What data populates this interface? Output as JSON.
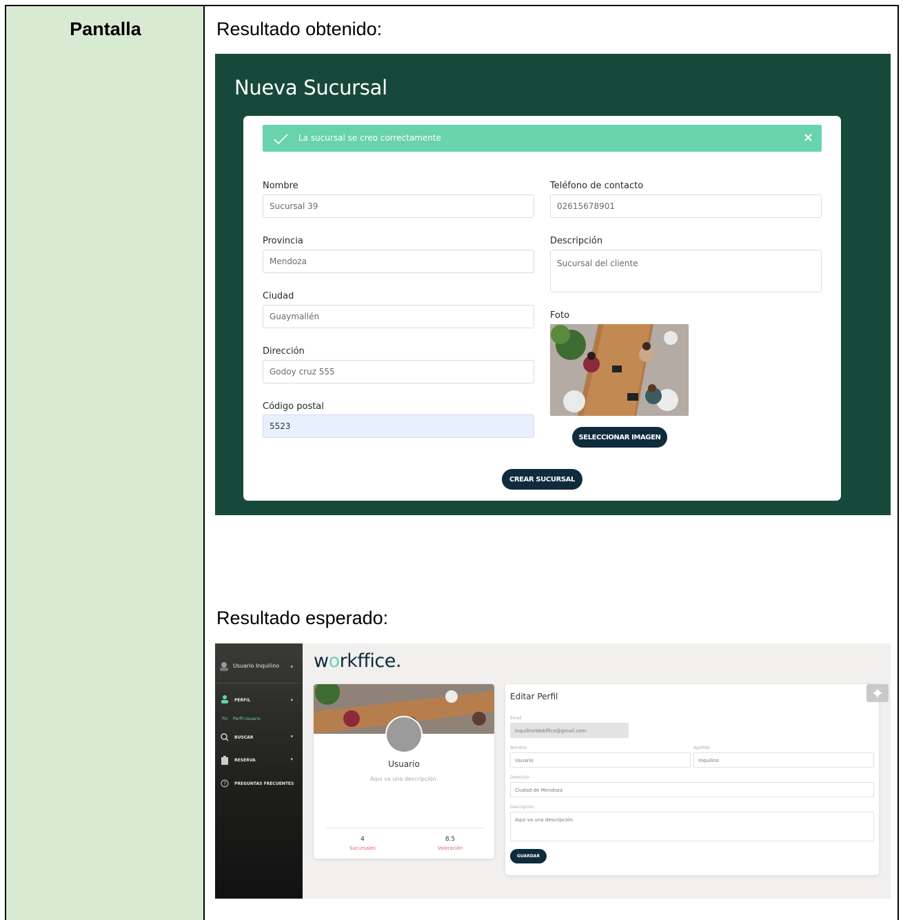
{
  "doc": {
    "left_header": "Pantalla",
    "obtained_title": "Resultado obtenido:",
    "expected_title": "Resultado esperado:"
  },
  "obtained": {
    "page_title": "Nueva Sucursal",
    "alert": {
      "message": "La sucursal se creo correctamente",
      "close": "×"
    },
    "fields": {
      "nombre": {
        "label": "Nombre",
        "value": "Sucursal 39"
      },
      "provincia": {
        "label": "Provincia",
        "value": "Mendoza"
      },
      "ciudad": {
        "label": "Ciudad",
        "value": "Guaymallén"
      },
      "direccion": {
        "label": "Dirección",
        "value": "Godoy cruz 555"
      },
      "codigo_postal": {
        "label": "Código postal",
        "value": "5523"
      },
      "telefono": {
        "label": "Teléfono de contacto",
        "value": "02615678901"
      },
      "descripcion": {
        "label": "Descripción",
        "value": "Sucursal del cliente"
      },
      "foto": {
        "label": "Foto"
      }
    },
    "select_image_button": "SELECCIONAR IMAGEN",
    "create_button": "CREAR SUCURSAL",
    "colors": {
      "background": "#17493a",
      "alert": "#69d3ad",
      "button": "#0f2c3d"
    }
  },
  "expected": {
    "logo": {
      "pre": "w",
      "o": "o",
      "post": "rkffice."
    },
    "sidebar": {
      "user": "Usuario Inquilino",
      "items": [
        {
          "label": "PERFIL",
          "icon": "user-icon"
        },
        {
          "label": "Perfil Usuario",
          "prefix": "PU"
        },
        {
          "label": "BUSCAR",
          "icon": "search-icon"
        },
        {
          "label": "RESERVA",
          "icon": "clipboard-icon"
        },
        {
          "label": "PREGUNTAS FRECUENTES",
          "icon": "help-icon"
        }
      ]
    },
    "profile": {
      "name": "Usuario",
      "description": "Aqui va una descripción.",
      "stats": [
        {
          "value": "4",
          "label": "Sucursales"
        },
        {
          "value": "8.5",
          "label": "Valoración"
        }
      ]
    },
    "edit": {
      "title": "Editar Perfil",
      "email_label": "Email",
      "email_value": "inquilinoWokffice@gmail.com",
      "nombre_label": "Nombre",
      "nombre_value": "Usuario",
      "apellido_label": "Apellido",
      "apellido_value": "Inquilino",
      "domicilio_label": "Domicilio",
      "domicilio_value": "Ciudad de Mendoza",
      "descripcion_label": "Descripción",
      "descripcion_value": "Aqui va una descripción.",
      "save_button": "GUARDAR"
    }
  }
}
